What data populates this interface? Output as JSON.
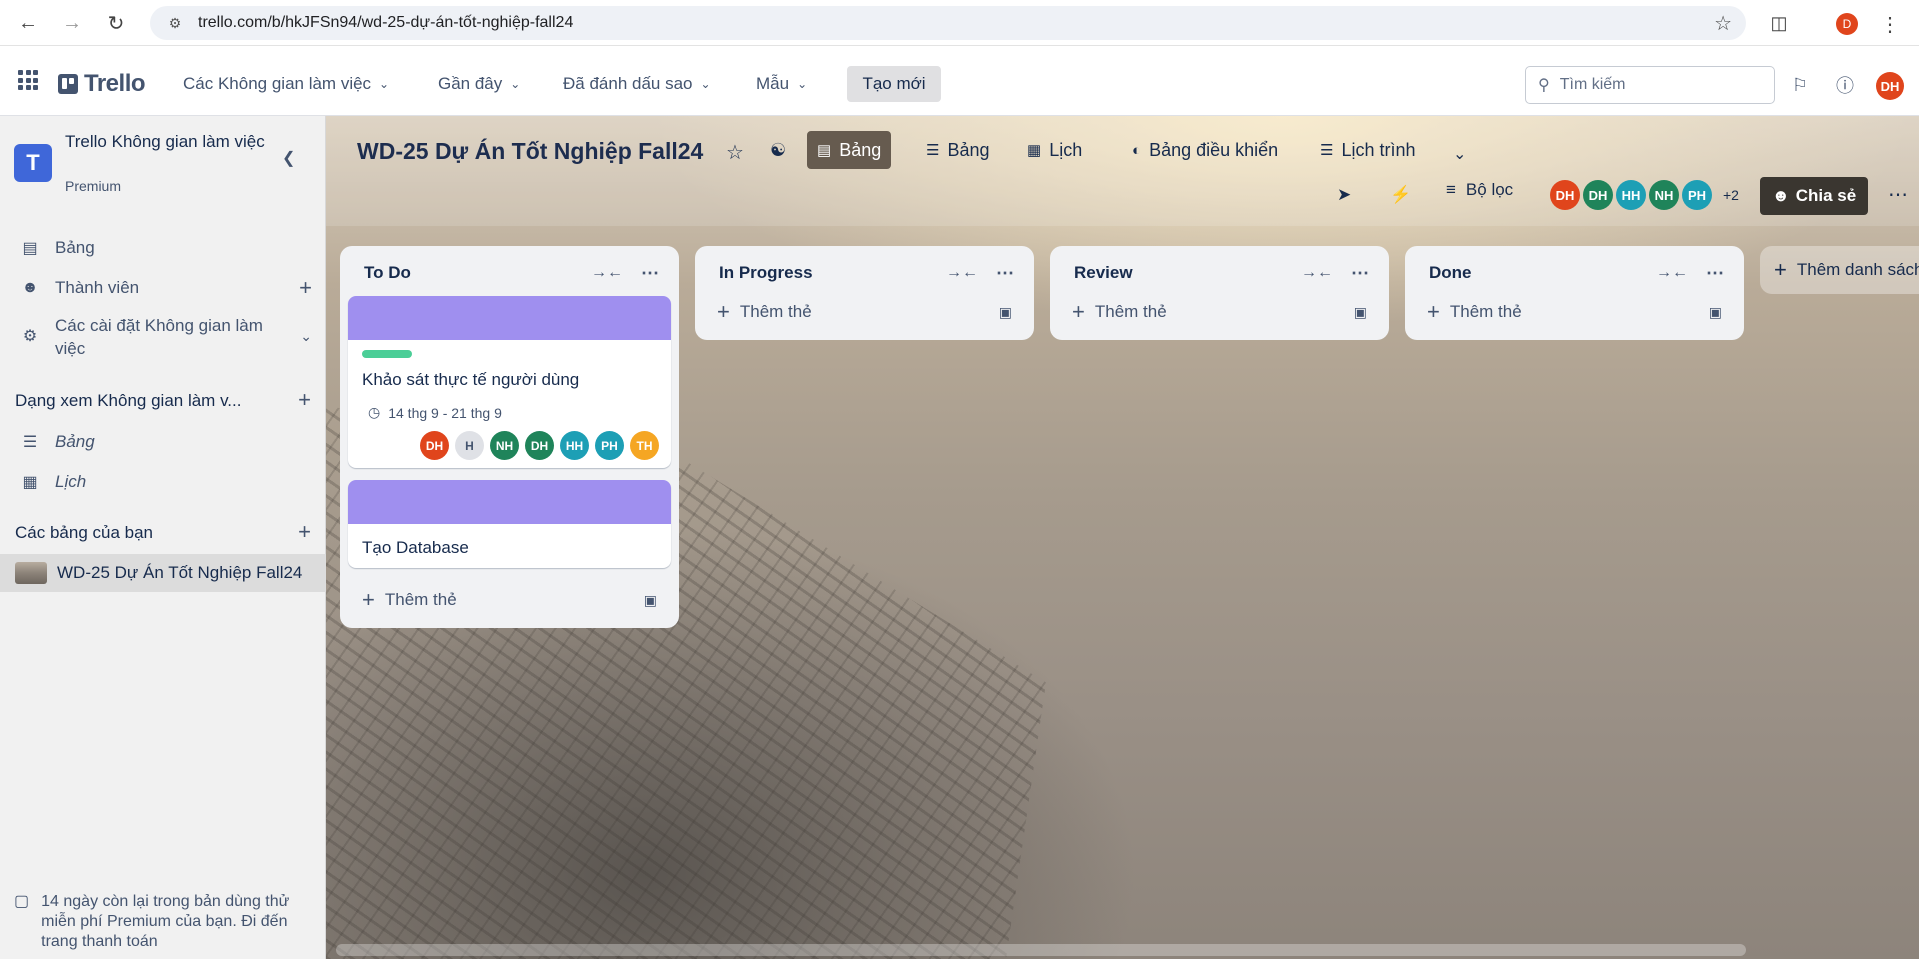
{
  "browser": {
    "url": "trello.com/b/hkJFSn94/wd-25-dự-án-tốt-nghiệp-fall24",
    "profile_initial": "D"
  },
  "header": {
    "logo": "Trello",
    "menus": [
      "Các Không gian làm việc",
      "Gần đây",
      "Đã đánh dấu sao",
      "Mẫu"
    ],
    "create_label": "Tạo mới",
    "search_placeholder": "Tìm kiếm",
    "avatar": "DH"
  },
  "sidebar": {
    "workspace_initial": "T",
    "workspace_name": "Trello Không gian làm việc",
    "workspace_plan": "Premium",
    "items": [
      {
        "label": "Bảng",
        "icon": "board-icon"
      },
      {
        "label": "Thành viên",
        "icon": "person-icon"
      },
      {
        "label": "Các cài đặt Không gian làm việc",
        "icon": "gear-icon"
      }
    ],
    "views_section": "Dạng xem Không gian làm v...",
    "views": [
      {
        "label": "Bảng",
        "icon": "table-icon"
      },
      {
        "label": "Lịch",
        "icon": "calendar-icon"
      }
    ],
    "boards_section": "Các bảng của bạn",
    "boards": [
      {
        "label": "WD-25 Dự Án Tốt Nghiệp Fall24"
      }
    ],
    "trial_text": "14 ngày còn lại trong bản dùng thử miễn phí Premium của bạn. Đi đến trang thanh toán"
  },
  "board": {
    "title": "WD-25 Dự Án Tốt Nghiệp Fall24",
    "views": [
      {
        "label": "Bảng",
        "icon": "board-icon",
        "active": true
      },
      {
        "label": "Bảng",
        "icon": "table-icon",
        "active": false
      },
      {
        "label": "Lịch",
        "icon": "calendar-icon",
        "active": false
      },
      {
        "label": "Bảng điều khiển",
        "icon": "dashboard-icon",
        "active": false
      },
      {
        "label": "Lịch trình",
        "icon": "timeline-icon",
        "active": false
      }
    ],
    "filter_label": "Bộ lọc",
    "members": [
      {
        "initials": "DH",
        "color": "#e0451c"
      },
      {
        "initials": "DH",
        "color": "#1f845a"
      },
      {
        "initials": "HH",
        "color": "#1d9fb5"
      },
      {
        "initials": "NH",
        "color": "#1f845a"
      },
      {
        "initials": "PH",
        "color": "#1d9fb5"
      }
    ],
    "members_more": "+2",
    "share_label": "Chia sẻ",
    "add_list_label": "Thêm danh sách",
    "add_card_label": "Thêm thẻ",
    "lists": [
      {
        "title": "To Do",
        "cards": [
          {
            "title": "Khảo sát thực tế người dùng",
            "cover": "#9f8fef",
            "label_color": "#4bce97",
            "date": "14 thg 9 - 21 thg 9",
            "members": [
              {
                "initials": "DH",
                "color": "#e0451c"
              },
              {
                "initials": "H",
                "color": "#dfe1e6"
              },
              {
                "initials": "NH",
                "color": "#1f845a"
              },
              {
                "initials": "DH",
                "color": "#1f845a"
              },
              {
                "initials": "HH",
                "color": "#1d9fb5"
              },
              {
                "initials": "PH",
                "color": "#1d9fb5"
              },
              {
                "initials": "TH",
                "color": "#f5a623"
              }
            ]
          },
          {
            "title": "Tạo Database",
            "cover": "#9f8fef"
          }
        ]
      },
      {
        "title": "In Progress",
        "cards": []
      },
      {
        "title": "Review",
        "cards": []
      },
      {
        "title": "Done",
        "cards": []
      }
    ]
  }
}
